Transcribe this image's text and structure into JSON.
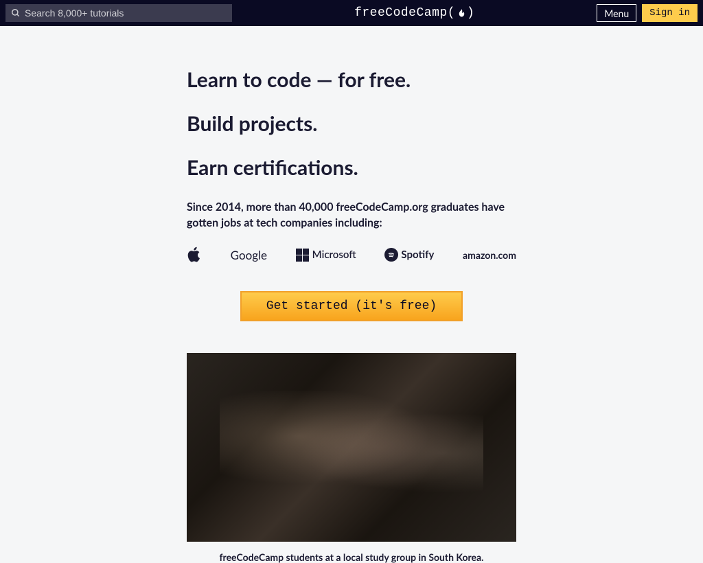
{
  "nav": {
    "search_placeholder": "Search 8,000+ tutorials",
    "logo_text": "freeCodeCamp",
    "menu_label": "Menu",
    "signin_label": "Sign in"
  },
  "hero": {
    "heading1": "Learn to code — for free.",
    "heading2": "Build projects.",
    "heading3": "Earn certifications.",
    "subheading": "Since 2014, more than 40,000 freeCodeCamp.org graduates have gotten jobs at tech companies including:",
    "companies": {
      "google": "Google",
      "microsoft": "Microsoft",
      "spotify": "Spotify",
      "amazon": "amazon.com"
    },
    "cta_label": "Get started (it's free)",
    "image_caption": "freeCodeCamp students at a local study group in South Korea."
  }
}
